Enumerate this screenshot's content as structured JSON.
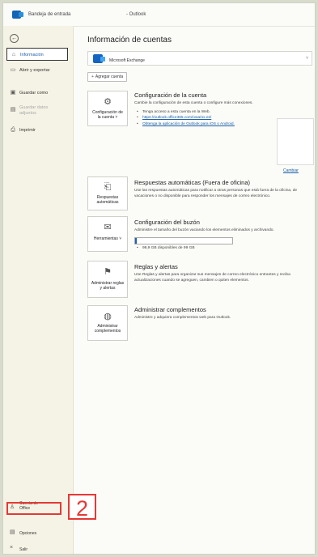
{
  "window": {
    "title_left": "Bandeja de entrada -",
    "title_right": "- Outlook"
  },
  "sidebar": {
    "back_icon": "back-arrow-icon",
    "items": [
      {
        "label": "Información",
        "icon": "home-icon",
        "active": true
      },
      {
        "label": "Abrir y exportar",
        "icon": "folder-open-icon"
      },
      {
        "label": "Guardar como",
        "icon": "save-as-icon"
      },
      {
        "label": "Guardar datos adjuntos",
        "icon": "attachment-save-icon",
        "disabled": true
      },
      {
        "label": "Imprimir",
        "icon": "printer-icon"
      }
    ],
    "bottom": [
      {
        "label": "Cuenta de Office",
        "icon": "person-icon"
      },
      {
        "label": "Opciones",
        "icon": "options-icon"
      },
      {
        "label": "Salir",
        "icon": "close-icon"
      }
    ]
  },
  "main": {
    "title": "Información de cuentas",
    "account": "Microsoft Exchange",
    "add_account": "Agregar cuenta",
    "account_settings": {
      "tile": "Configuración de la cuenta ˅",
      "title": "Configuración de la cuenta",
      "desc": "Cambie la configuración de esta cuenta o configure más conexiones.",
      "bullet1": "Tenga acceso a esta cuenta en la Web.",
      "link1": "https://outlook.office365.com/owa/ox.es/",
      "link2": "Obtenga la aplicación de Outlook para iOS o Android.",
      "change_photo": "Cambiar"
    },
    "auto_replies": {
      "tile": "Respuestas automáticas",
      "title": "Respuestas automáticas (Fuera de oficina)",
      "desc": "Use las respuestas automáticas para notificar a otras personas que está fuera de la oficina, de vacaciones o no disponible para responder los mensajes de correo electrónico."
    },
    "mailbox": {
      "tile": "Herramientas ˅",
      "title": "Configuración del buzón",
      "desc": "Administre el tamaño del buzón vaciando los elementos eliminados y archivando.",
      "usage": "98,9 GB disponibles de 99 GB",
      "used_fraction": 0.01
    },
    "rules": {
      "tile": "Administrar reglas y alertas",
      "title": "Reglas y alertas",
      "desc": "Use Reglas y alertas para organizar sus mensajes de correo electrónico entrantes y reciba actualizaciones cuando se agreguen, cambien o quiten elementos."
    },
    "addins": {
      "tile": "Administrar complementos",
      "title": "Administrar complementos",
      "desc": "Administre y adquiera complementos web para Outlook."
    }
  },
  "annotation": {
    "number": "2",
    "color": "#e53935"
  }
}
